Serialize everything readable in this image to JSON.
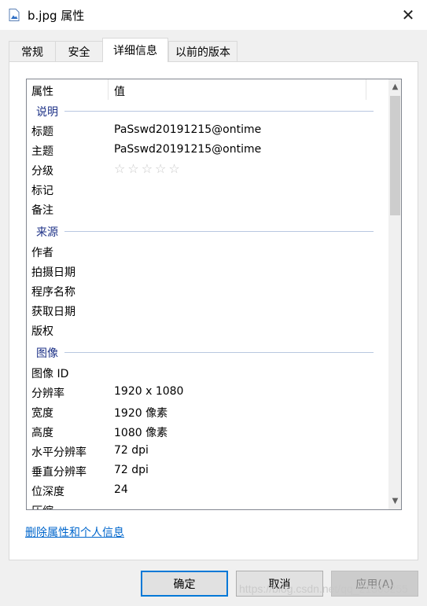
{
  "window": {
    "title": "b.jpg 属性",
    "icon": "image-file-icon"
  },
  "tabs": [
    {
      "label": "常规"
    },
    {
      "label": "安全"
    },
    {
      "label": "详细信息",
      "active": true
    },
    {
      "label": "以前的版本"
    }
  ],
  "list": {
    "col_property": "属性",
    "col_value": "值",
    "groups": {
      "description": "说明",
      "origin": "来源",
      "image": "图像"
    },
    "rows": {
      "title_label": "标题",
      "title_value": "PaSswd20191215@ontime",
      "subject_label": "主题",
      "subject_value": "PaSswd20191215@ontime",
      "rating_label": "分级",
      "rating_stars": "☆☆☆☆☆",
      "rating_value": 0,
      "tags_label": "标记",
      "comments_label": "备注",
      "author_label": "作者",
      "date_taken_label": "拍摄日期",
      "program_label": "程序名称",
      "date_acquired_label": "获取日期",
      "copyright_label": "版权",
      "image_id_label": "图像 ID",
      "dimensions_label": "分辨率",
      "dimensions_value": "1920 x 1080",
      "width_label": "宽度",
      "width_value": "1920 像素",
      "height_label": "高度",
      "height_value": "1080 像素",
      "hres_label": "水平分辨率",
      "hres_value": "72 dpi",
      "vres_label": "垂直分辨率",
      "vres_value": "72 dpi",
      "bitdepth_label": "位深度",
      "bitdepth_value": "24",
      "compression_label": "压缩"
    }
  },
  "remove_link": "删除属性和个人信息",
  "buttons": {
    "ok": "确定",
    "cancel": "取消",
    "apply": "应用(A)"
  },
  "watermark": "https://blog.csdn.net/qq_21305255",
  "colors": {
    "link": "#0066cc",
    "group_header": "#1e3287",
    "accent": "#0078d7"
  }
}
